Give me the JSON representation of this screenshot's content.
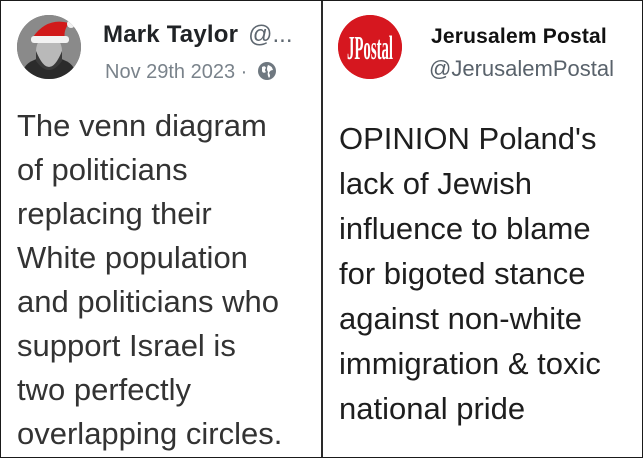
{
  "left_post": {
    "display_name": "Mark Taylor",
    "handle": "@...",
    "date": "Nov 29th 2023",
    "separator": "·",
    "text": "The venn diagram\nof politicians\nreplacing their\nWhite population\nand politicians who\nsupport Israel is\ntwo perfectly\noverlapping circles."
  },
  "right_post": {
    "display_name": "Jerusalem Postal",
    "handle": "@JerusalemPostal",
    "avatar_logo_text": "JPostal",
    "text": "OPINION Poland's\nlack of Jewish\ninfluence to blame\nfor bigoted stance\nagainst non-white\nimmigration & toxic\nnational pride"
  },
  "colors": {
    "brand_red": "#d6171f",
    "name_text": "#202326",
    "handle_text": "#5e6770"
  },
  "icons": {
    "left_meta_icon": "globe-icon"
  }
}
